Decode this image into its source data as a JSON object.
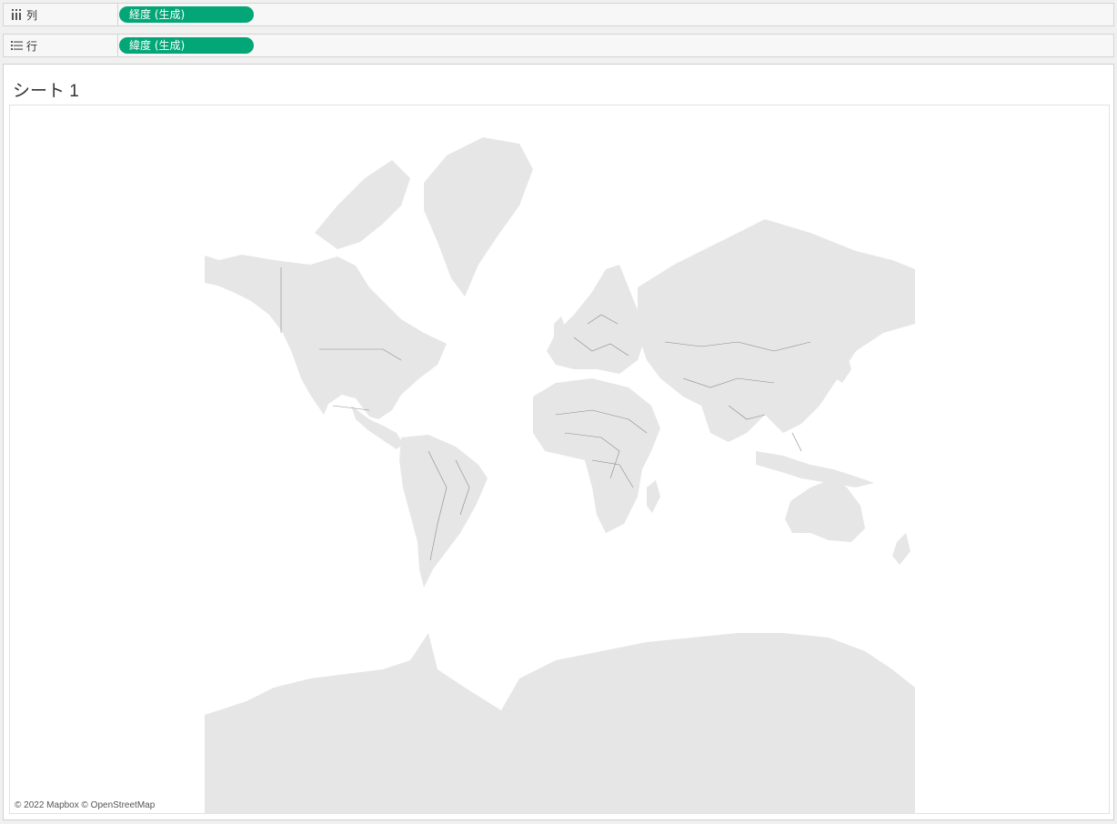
{
  "shelves": {
    "columns": {
      "label": "列",
      "icon": "columns-icon",
      "pill": "経度 (生成)"
    },
    "rows": {
      "label": "行",
      "icon": "rows-icon",
      "pill": "緯度 (生成)"
    }
  },
  "sheet": {
    "title": "シート 1"
  },
  "map": {
    "attribution": "© 2022 Mapbox © OpenStreetMap",
    "land_color": "#e6e6e6",
    "border_color": "#8a8a8a",
    "pill_color": "#03a777"
  }
}
